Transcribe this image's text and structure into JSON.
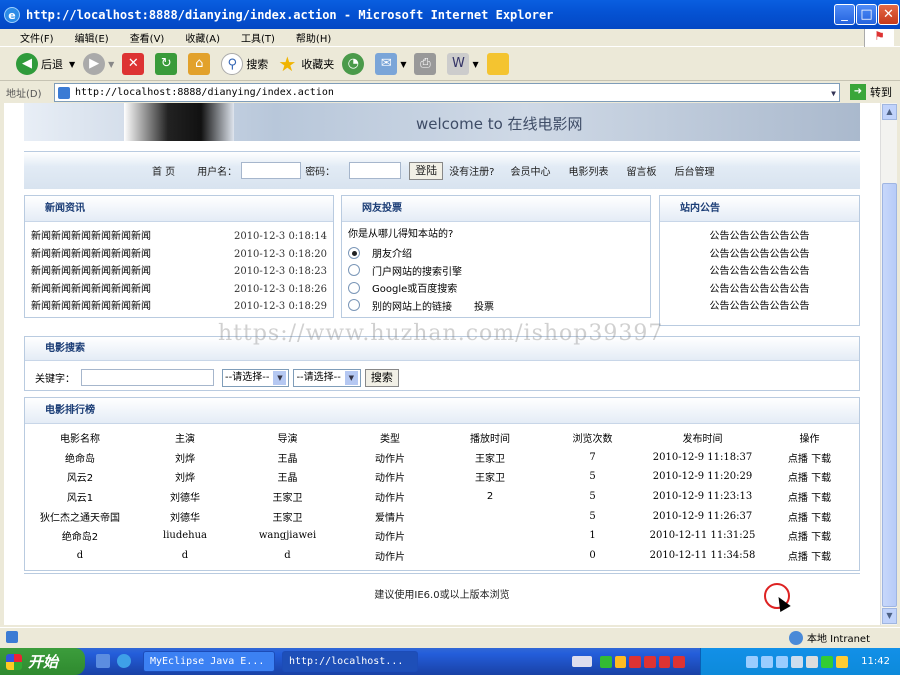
{
  "window": {
    "title": "http://localhost:8888/dianying/index.action - Microsoft Internet Explorer",
    "ie_glyph": "e",
    "min_glyph": "_",
    "max_glyph": "□",
    "close_glyph": "✕"
  },
  "menu": [
    "文件(F)",
    "编辑(E)",
    "查看(V)",
    "收藏(A)",
    "工具(T)",
    "帮助(H)"
  ],
  "toolbar": {
    "back": "后退",
    "search": "搜索",
    "favorites": "收藏夹"
  },
  "address": {
    "label": "地址(D)",
    "url": "http://localhost:8888/dianying/index.action",
    "go": "转到"
  },
  "banner": {
    "welcome": "welcome to 在线电影网"
  },
  "nav": {
    "home": "首 页",
    "username_label": "用户名：",
    "password_label": "密码：",
    "login_button": "登陆",
    "register": "没有注册?",
    "member": "会员中心",
    "movies": "电影列表",
    "guestbook": "留言板",
    "admin": "后台管理"
  },
  "news": {
    "title": "新闻资讯",
    "items": [
      {
        "text": "新闻新闻新闻新闻新闻新闻",
        "date": "2010-12-3 0:18:14"
      },
      {
        "text": "新闻新闻新闻新闻新闻新闻",
        "date": "2010-12-3 0:18:20"
      },
      {
        "text": "新闻新闻新闻新闻新闻新闻",
        "date": "2010-12-3 0:18:23"
      },
      {
        "text": "新闻新闻新闻新闻新闻新闻",
        "date": "2010-12-3 0:18:26"
      },
      {
        "text": "新闻新闻新闻新闻新闻新闻",
        "date": "2010-12-3 0:18:29"
      }
    ]
  },
  "poll": {
    "title": "网友投票",
    "question": "你是从哪儿得知本站的?",
    "options": [
      "朋友介绍",
      "门户网站的搜索引擎",
      "Google或百度搜索",
      "别的网站上的链接"
    ],
    "selected": 0,
    "vote": "投票"
  },
  "notice": {
    "title": "站内公告",
    "items": [
      "公告公告公告公告公告",
      "公告公告公告公告公告",
      "公告公告公告公告公告",
      "公告公告公告公告公告",
      "公告公告公告公告公告"
    ]
  },
  "watermark": "https://www.huzhan.com/ishop39397",
  "search": {
    "title": "电影搜索",
    "keyword_label": "关键字：",
    "select1": "--请选择--",
    "select2": "--请选择--",
    "button": "搜索"
  },
  "ranking": {
    "title": "电影排行榜",
    "headers": [
      "电影名称",
      "主演",
      "导演",
      "类型",
      "播放时间",
      "浏览次数",
      "发布时间",
      "操作"
    ],
    "rows": [
      [
        "绝命岛",
        "刘烨",
        "王晶",
        "动作片",
        "王家卫",
        "7",
        "2010-12-9 11:18:37"
      ],
      [
        "风云2",
        "刘烨",
        "王晶",
        "动作片",
        "王家卫",
        "5",
        "2010-12-9 11:20:29"
      ],
      [
        "风云1",
        "刘德华",
        "王家卫",
        "动作片",
        "2",
        "5",
        "2010-12-9 11:23:13"
      ],
      [
        "狄仁杰之通天帝国",
        "刘德华",
        "王家卫",
        "爱情片",
        "",
        "5",
        "2010-12-9 11:26:37"
      ],
      [
        "绝命岛2",
        "liudehua",
        "wangjiawei",
        "动作片",
        "",
        "1",
        "2010-12-11 11:31:25"
      ],
      [
        "d",
        "d",
        "d",
        "动作片",
        "",
        "0",
        "2010-12-11 11:34:58"
      ]
    ],
    "play": "点播",
    "download": "下载"
  },
  "footer": "建议使用IE6.0或以上版本浏览",
  "status": {
    "zone": "本地 Intranet"
  },
  "taskbar": {
    "start": "开始",
    "task1": "MyEclipse Java E...",
    "task2": "http://localhost...",
    "time": "11:42"
  },
  "colors": {
    "titlebar": "#0553d4",
    "panel_header_text": "#1b3d76",
    "taskbar": "#245edb",
    "start": "#2f8a2f"
  }
}
